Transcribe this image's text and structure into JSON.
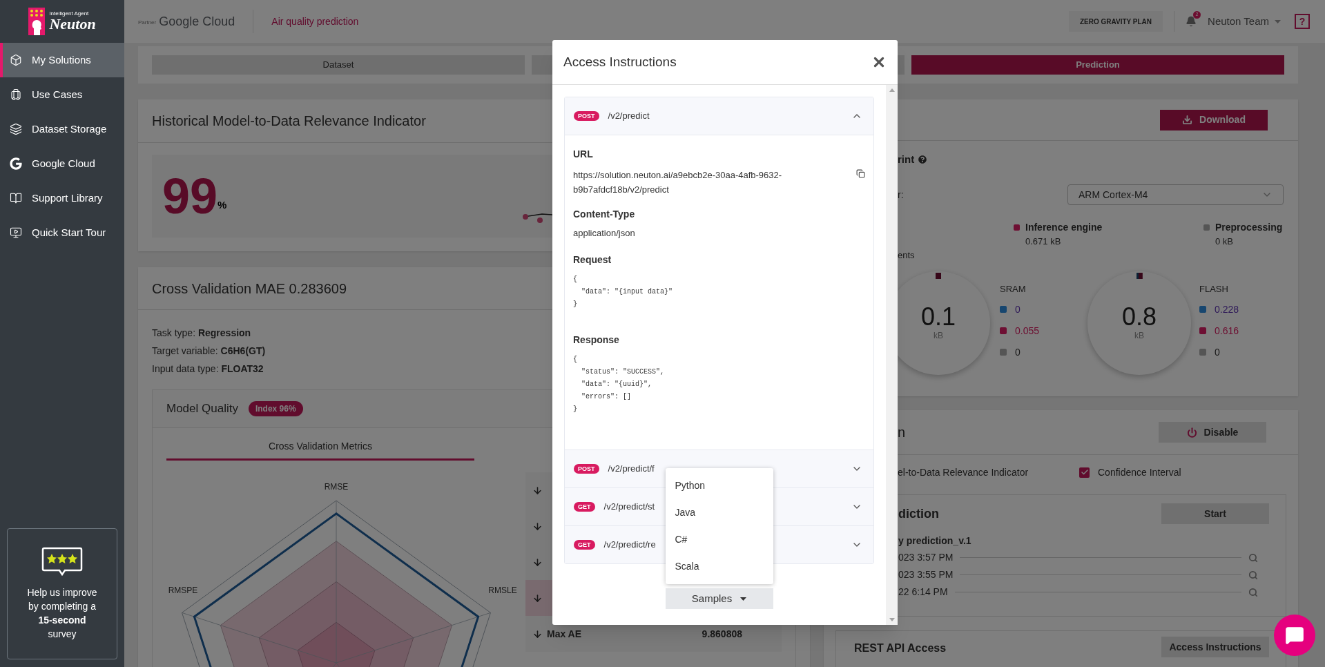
{
  "sidebar": {
    "logo": {
      "tagline": "Intelligent Agent",
      "name": "Neuton"
    },
    "items": [
      {
        "label": "My Solutions",
        "selected": true
      },
      {
        "label": "Use Cases",
        "selected": false
      },
      {
        "label": "Dataset Storage",
        "selected": false
      },
      {
        "label": "Google Cloud",
        "selected": false
      },
      {
        "label": "Support Library",
        "selected": false
      },
      {
        "label": "Quick Start Tour",
        "selected": false
      }
    ],
    "survey": "Help us improve by completing a **15-second** survey"
  },
  "header": {
    "partner_label": "Partner",
    "partner_name": "Google Cloud",
    "solution": "Air quality prediction",
    "plan": "ZERO GRAVITY PLAN",
    "notifications": "2",
    "user": "Neuton Team",
    "help": "?"
  },
  "tabs": [
    {
      "label": "Dataset",
      "selected": false
    },
    {
      "selected": false
    },
    {
      "label": "Prediction",
      "selected": true
    }
  ],
  "relevance": {
    "title": "Historical Model-to-Data Relevance Indicator",
    "value": "99",
    "unit": "%"
  },
  "validation": {
    "title": "Cross Validation MAE 0.283609",
    "info": [
      "Task type: **Regression**",
      "Target variable: **C6H6(GT)**",
      "Input data type: **FLOAT32**"
    ],
    "quality": {
      "title": "Model Quality",
      "badge": "Index 96%",
      "tab": {
        "label": "Cross Validation Metrics",
        "selected": true
      },
      "axes": [
        "RMSE",
        "RMSLE",
        "RMSPE"
      ],
      "metrics": [
        {
          "selected": false
        },
        {
          "selected": false
        },
        {
          "selected": false
        },
        {
          "selected": true
        },
        {
          "label": "Max AE",
          "value": "9.860808",
          "selected": false
        }
      ]
    }
  },
  "footprint": {
    "download": "Download",
    "title": "rint",
    "target_label": "r:",
    "target": "ARM Cortex-M4",
    "legend": [
      {
        "label": "Inference engine",
        "value": "0.671 kB",
        "color": "#6e0f33"
      },
      {
        "label": "Preprocessing",
        "value": "0 kB",
        "color": "#555555"
      }
    ],
    "section": "ents",
    "gauges": [
      {
        "value": "0.1",
        "unit": "kB",
        "name": "SRAM",
        "rows": [
          {
            "value": "0",
            "color": "#17466f"
          },
          {
            "value": "0.055",
            "color": "#6e0f33"
          },
          {
            "value": "0",
            "color": "#555555"
          }
        ]
      },
      {
        "value": "0.8",
        "unit": "kB",
        "name": "FLASH",
        "rows": [
          {
            "value": "0.228",
            "color": "#17466f"
          },
          {
            "value": "0.616",
            "color": "#6e0f33"
          },
          {
            "value": "0",
            "color": "#555555"
          }
        ]
      }
    ]
  },
  "prediction": {
    "title": "n",
    "disable": "Disable",
    "options": [
      {
        "label": "el-to-Data Relevance Indicator"
      },
      {
        "label": "Confidence Interval",
        "checked": true
      }
    ],
    "batch": {
      "title": "diction",
      "start": "Start",
      "name": "y prediction_v.1",
      "runs": [
        "023 3:57 PM",
        "023 3:55 PM",
        "22 6:14 PM"
      ]
    },
    "rest": {
      "title": "REST API Access",
      "button": "Access Instructions"
    }
  },
  "modal": {
    "title": "Access Instructions",
    "endpoints": [
      {
        "method": "POST",
        "path": "/v2/predict",
        "expanded": true,
        "details": [
          {
            "kind": "copy",
            "label": "URL",
            "value": "https://solution.neuton.ai/a9ebcb2e-30aa-4afb-9632-b9b7afdcf18b/v2/predict"
          },
          {
            "kind": "text",
            "label": "Content-Type",
            "value": "application/json"
          },
          {
            "kind": "code",
            "label": "Request",
            "value": "{\n  \"data\": \"{input data}\"\n}"
          },
          {
            "kind": "code",
            "label": "Response",
            "value": "{\n  \"status\": \"SUCCESS\",\n  \"data\": \"{uuid}\",\n  \"errors\": []\n}"
          }
        ]
      },
      {
        "method": "POST",
        "path": "/v2/predict/f",
        "expanded": false
      },
      {
        "method": "GET",
        "path": "/v2/predict/st",
        "expanded": false
      },
      {
        "method": "GET",
        "path": "/v2/predict/re",
        "expanded": false
      }
    ],
    "samples": {
      "label": "Samples",
      "expanded": true,
      "options": [
        "Python",
        "Java",
        "C#",
        "Scala"
      ]
    }
  }
}
